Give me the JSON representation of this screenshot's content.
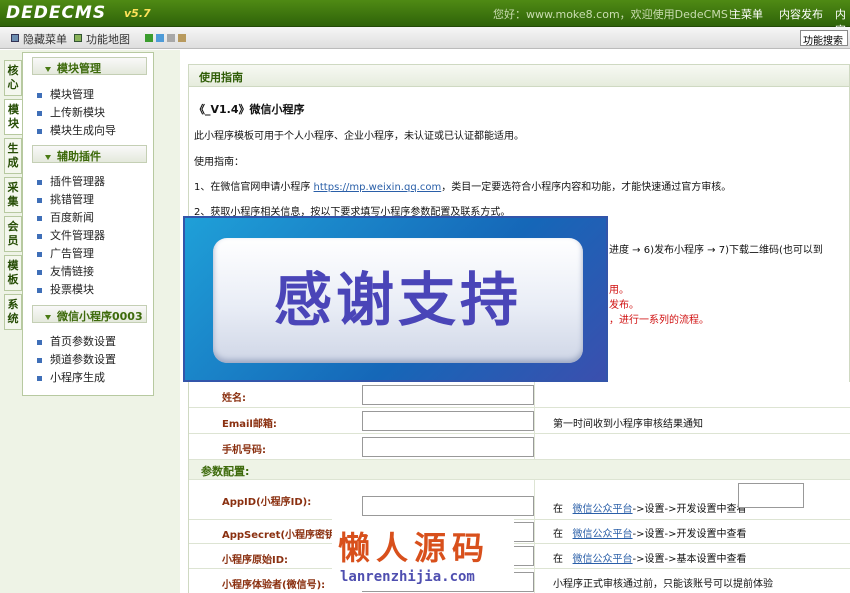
{
  "topbar": {
    "logo": "DEDECMS",
    "version": "v5.7",
    "welcome": "您好：www.moke8.com，欢迎使用DedeCMS！",
    "nav": [
      "主菜单",
      "内容发布",
      "内容"
    ]
  },
  "subbar": {
    "hide_menu": "隐藏菜单",
    "func_map": "功能地图",
    "func_search": "功能搜索"
  },
  "vtabs": [
    "核心",
    "模块",
    "生成",
    "采集",
    "会员",
    "模板",
    "系统"
  ],
  "menu": [
    {
      "title": "模块管理",
      "items": [
        "模块管理",
        "上传新模块",
        "模块生成向导"
      ]
    },
    {
      "title": "辅助插件",
      "items": [
        "插件管理器",
        "挑错管理",
        "百度新闻",
        "文件管理器",
        "广告管理",
        "友情链接",
        "投票模块"
      ]
    },
    {
      "title": "微信小程序0003",
      "items": [
        "首页参数设置",
        "频道参数设置",
        "小程序生成"
      ]
    }
  ],
  "panel": {
    "head": "使用指南",
    "title": "《_V1.4》微信小程序",
    "intro": "此小程序模板可用于个人小程序、企业小程序，未认证或已认证都能适用。",
    "guide": "使用指南：",
    "step1_a": "1、在微信官网申请小程序 ",
    "step1_link": "https://mp.weixin.qq.com",
    "step1_b": "，类目一定要选符合小程序内容和功能，才能快速通过官方审核。",
    "step2": "2、获取小程序相关信息，按以下要求填写小程序参数配置及联系方式。",
    "step_cut": "进度  →  6)发布小程序  →  7)下载二维码(也可以到",
    "red1": "用。",
    "red2": "发布。",
    "red3": "，进行一系列的流程。"
  },
  "banner": {
    "text": "感谢支持"
  },
  "form": {
    "name_label": "姓名:",
    "email_label": "Email邮箱:",
    "email_hint": "第一时间收到小程序审核结果通知",
    "phone_label": "手机号码:",
    "section": "参数配置:",
    "appid_label": "AppID(小程序ID):",
    "secret_label": "AppSecret(小程序密钥):",
    "origin_label": "小程序原始ID:",
    "tester_label": "小程序体验者(微信号):",
    "at": "在",
    "wx_link": "微信公众平台",
    "appid_hint": "->设置->开发设置中查看",
    "secret_hint": "->设置->开发设置中查看",
    "origin_hint": "->设置->基本设置中查看",
    "tester_hint": "小程序正式审核通过前，只能该账号可以提前体验"
  },
  "watermark": {
    "cn": "懒人源码",
    "url": "lanrenzhijia.com"
  }
}
